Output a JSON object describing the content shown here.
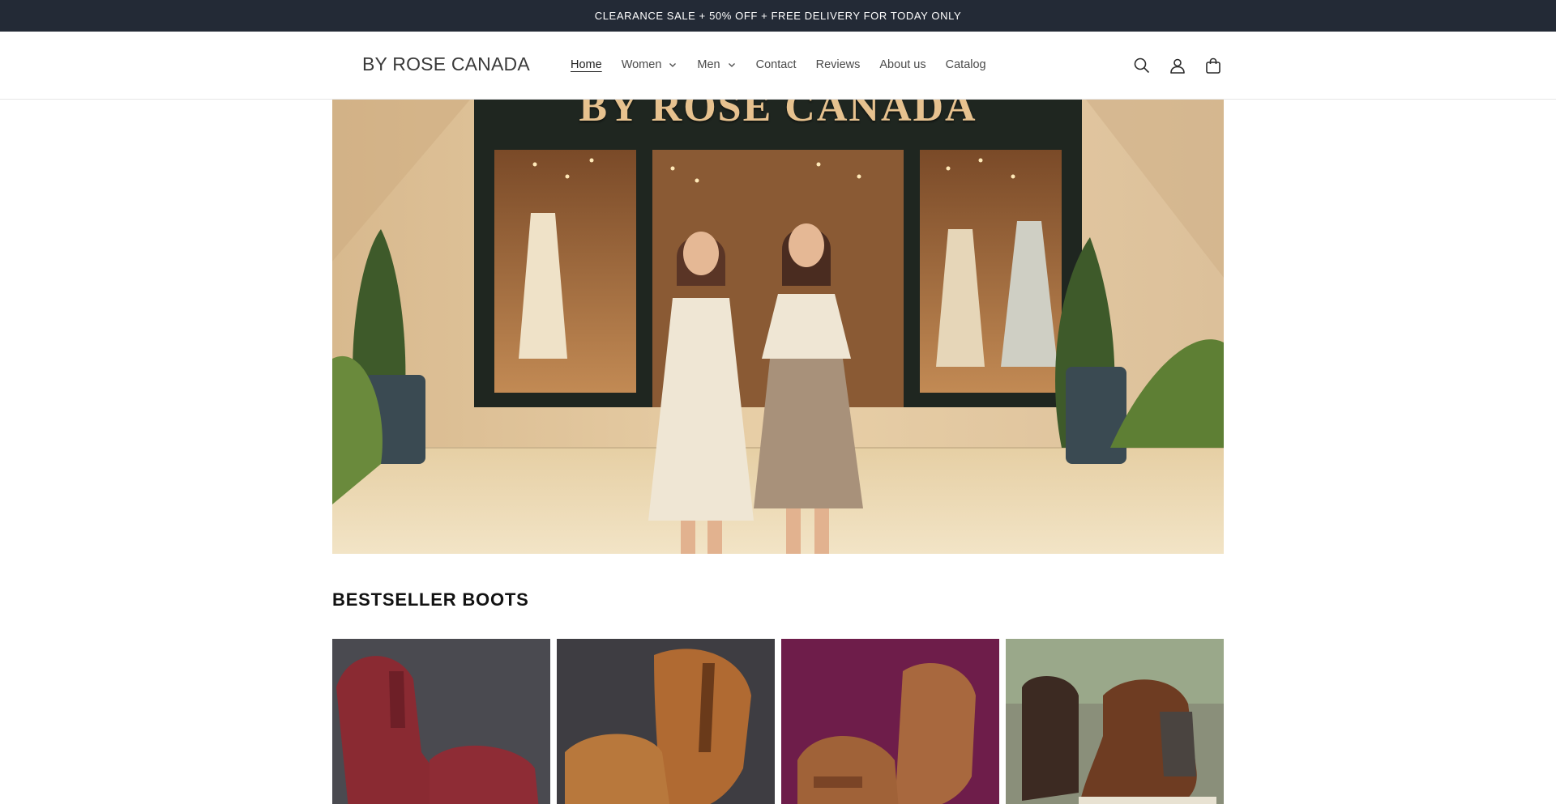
{
  "announcement": {
    "text": "CLEARANCE SALE + 50% OFF + FREE DELIVERY FOR TODAY ONLY"
  },
  "header": {
    "logo": "BY ROSE CANADA",
    "nav": [
      {
        "label": "Home",
        "active": true,
        "dropdown": false
      },
      {
        "label": "Women",
        "active": false,
        "dropdown": true
      },
      {
        "label": "Men",
        "active": false,
        "dropdown": true
      },
      {
        "label": "Contact",
        "active": false,
        "dropdown": false
      },
      {
        "label": "Reviews",
        "active": false,
        "dropdown": false
      },
      {
        "label": "About us",
        "active": false,
        "dropdown": false
      },
      {
        "label": "Catalog",
        "active": false,
        "dropdown": false
      }
    ],
    "icons": [
      "search-icon",
      "account-icon",
      "cart-icon"
    ]
  },
  "hero": {
    "sign_text": "BY ROSE CANADA"
  },
  "section": {
    "title": "BESTSELLER BOOTS",
    "products": [
      {
        "color": "burgundy",
        "background": "#4a4a50",
        "boot": "#8a2a32"
      },
      {
        "color": "tan",
        "background": "#3e3d42",
        "boot": "#b06a32"
      },
      {
        "color": "brown",
        "background": "#6e1d4a",
        "boot": "#a8683e"
      },
      {
        "color": "chestnut",
        "background": "#8a8f7a",
        "boot": "#6e3c22"
      }
    ]
  },
  "colors": {
    "announcement_bg": "#232a36",
    "text": "#121212"
  }
}
